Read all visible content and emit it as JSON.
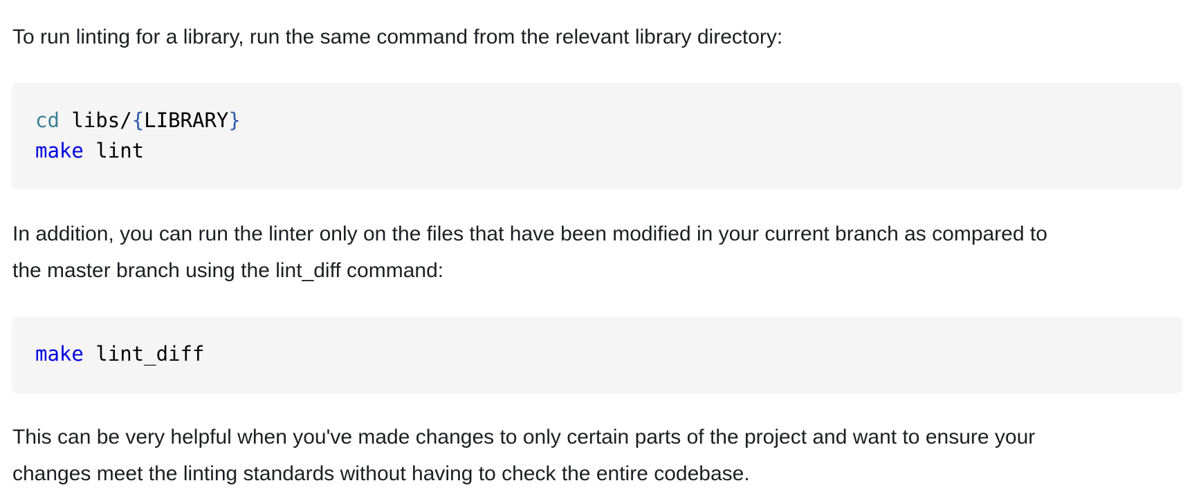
{
  "paragraphs": {
    "intro": "To run linting for a library, run the same command from the relevant library directory:",
    "addition_line1": "In addition, you can run the linter only on the files that have been modified in your current branch as compared to",
    "addition_line2": "the master branch using the lint_diff command:",
    "helpful_line1": "This can be very helpful when you've made changes to only certain parts of the project and want to ensure your",
    "helpful_line2": "changes meet the linting standards without having to check the entire codebase."
  },
  "code_block_1": {
    "line1": {
      "builtin": "cd",
      "path_prefix": " libs/",
      "brace_open": "{",
      "variable": "LIBRARY",
      "brace_close": "}"
    },
    "line2": {
      "command": "make",
      "target": " lint"
    }
  },
  "code_block_2": {
    "line1": {
      "command": "make",
      "target": " lint_diff"
    }
  },
  "colors": {
    "builtin": "#3b7f97",
    "command": "#0000e0",
    "brace": "#2d5aa8",
    "code_background": "#f5f5f5",
    "text": "#1c1e21"
  }
}
